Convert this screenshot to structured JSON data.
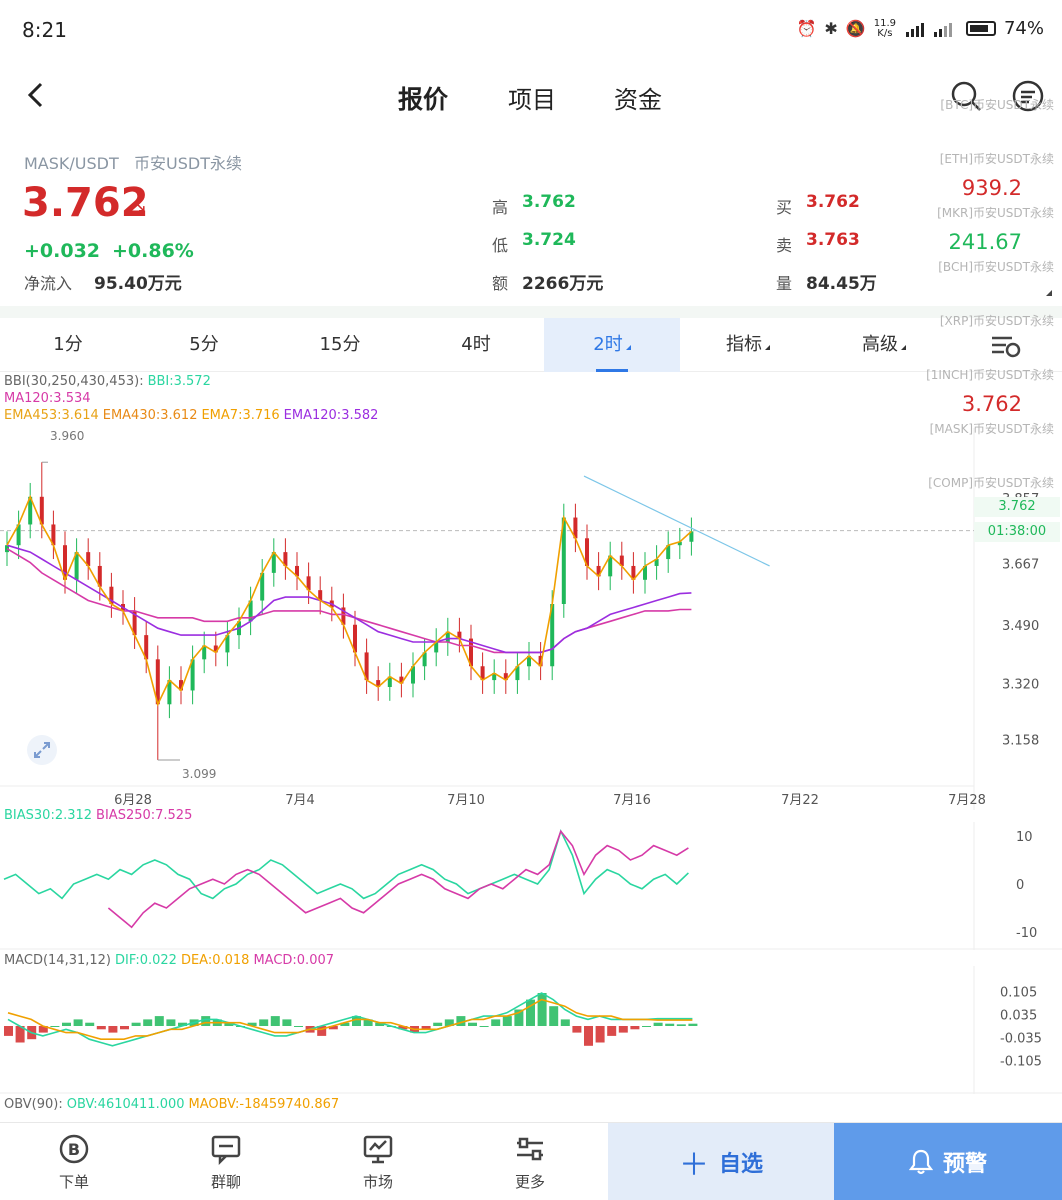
{
  "status": {
    "time": "8:21",
    "net_speed_top": "11.9",
    "net_speed_bottom": "K/s",
    "battery": "74%",
    "battery_level": 0.74
  },
  "nav": {
    "tabs": [
      "报价",
      "项目",
      "资金"
    ],
    "active_tab": "报价"
  },
  "ticker_overlay": {
    "items": [
      {
        "label": "[BTC]币安USDT永续",
        "price": ""
      },
      {
        "label": "[ETH]币安USDT永续",
        "price": "939.2"
      },
      {
        "label": "[MKR]币安USDT永续",
        "price": "241.67"
      },
      {
        "label": "[BCH]币安USDT永续",
        "price": ""
      },
      {
        "label": "[XRP]币安USDT永续",
        "price": "3.762"
      },
      {
        "label": "[1INCH]币安USDT永续",
        "price": ""
      },
      {
        "label": "[MASK]币安USDT永续",
        "price": ""
      },
      {
        "label": "[COMP]币安USDT永续",
        "price": ""
      }
    ],
    "price_colors": [
      "#d32a2a",
      "#1fb85a",
      "#d32a2a"
    ]
  },
  "quote": {
    "pair": "MASK/USDT",
    "exchange": "币安USDT永续",
    "price": "3.762",
    "trend_icon": "arrow-down-right",
    "change": "+0.032",
    "change_pct": "+0.86%",
    "net_inflow_label": "净流入",
    "net_inflow": "95.40万元",
    "high_label": "高",
    "high": "3.762",
    "low_label": "低",
    "low": "3.724",
    "amount_label": "额",
    "amount": "2266万元",
    "bid_label": "买",
    "bid": "3.762",
    "ask_label": "卖",
    "ask": "3.763",
    "volume_label": "量",
    "volume": "84.45万"
  },
  "timeframes": {
    "items": [
      "1分",
      "5分",
      "15分",
      "4时",
      "2时",
      "指标",
      "高级"
    ],
    "active": "2时",
    "settings_icon": "chart-settings-icon"
  },
  "main_chart": {
    "legend_bbi": "BBI(30,250,430,453):",
    "legend_bbi_val": "BBI:3.572",
    "legend_ma": "MA120:3.534",
    "legend_ema453": "EMA453:3.614",
    "legend_ema430": "EMA430:3.612",
    "legend_ema7": "EMA7:3.716",
    "legend_ema120": "EMA120:3.582",
    "high_marker": "3.960",
    "low_marker": "3.099",
    "price_box": "3.762",
    "countdown_box": "01:38:00",
    "expand_icon": "expand-icon"
  },
  "bias": {
    "legend_30": "BIAS30:2.312",
    "legend_250": "BIAS250:7.525"
  },
  "macd": {
    "legend_name": "MACD(14,31,12)",
    "legend_dif": "DIF:0.022",
    "legend_dea": "DEA:0.018",
    "legend_macd": "MACD:0.007"
  },
  "obv": {
    "legend_name": "OBV(90):",
    "legend_obv": "OBV:4610411.000",
    "legend_maobv": "MAOBV:-18459740.867"
  },
  "chart_data": [
    {
      "type": "candlestick",
      "title": "",
      "x": [
        "6月28",
        "7月4",
        "7月10",
        "7月16",
        "7月22",
        "7月28"
      ],
      "y_ticks": [
        3.857,
        3.667,
        3.49,
        3.32,
        3.158
      ],
      "y_tick_labels": [
        "3.857",
        "3.667",
        "3.490",
        "3.320",
        "3.158"
      ],
      "ylim": [
        3.07,
        4.03
      ],
      "high": 3.96,
      "low": 3.099,
      "last": 3.762,
      "series": [
        {
          "name": "close",
          "values": [
            3.72,
            3.78,
            3.86,
            3.78,
            3.72,
            3.62,
            3.7,
            3.66,
            3.6,
            3.55,
            3.53,
            3.46,
            3.39,
            3.26,
            3.33,
            3.3,
            3.39,
            3.43,
            3.41,
            3.46,
            3.5,
            3.56,
            3.64,
            3.7,
            3.66,
            3.63,
            3.59,
            3.56,
            3.54,
            3.49,
            3.41,
            3.33,
            3.31,
            3.34,
            3.32,
            3.37,
            3.41,
            3.44,
            3.47,
            3.45,
            3.37,
            3.33,
            3.35,
            3.33,
            3.37,
            3.4,
            3.37,
            3.55,
            3.8,
            3.74,
            3.66,
            3.63,
            3.69,
            3.66,
            3.62,
            3.66,
            3.68,
            3.72,
            3.73,
            3.76
          ]
        },
        {
          "name": "MA120",
          "values": [
            3.71,
            3.69,
            3.67,
            3.64,
            3.62,
            3.6,
            3.58,
            3.56,
            3.55,
            3.54,
            3.53,
            3.53,
            3.52,
            3.51,
            3.51,
            3.51,
            3.51,
            3.5,
            3.5,
            3.5,
            3.51,
            3.51,
            3.52,
            3.53,
            3.53,
            3.53,
            3.53,
            3.53,
            3.52,
            3.52,
            3.51,
            3.5,
            3.49,
            3.48,
            3.47,
            3.46,
            3.45,
            3.44,
            3.44,
            3.43,
            3.43,
            3.42,
            3.41,
            3.41,
            3.41,
            3.41,
            3.41,
            3.42,
            3.45,
            3.47,
            3.48,
            3.49,
            3.5,
            3.51,
            3.52,
            3.53,
            3.53,
            3.53,
            3.534,
            3.534
          ]
        },
        {
          "name": "EMA120",
          "values": [
            3.72,
            3.71,
            3.7,
            3.68,
            3.66,
            3.64,
            3.62,
            3.6,
            3.58,
            3.56,
            3.54,
            3.52,
            3.5,
            3.48,
            3.47,
            3.46,
            3.46,
            3.46,
            3.46,
            3.47,
            3.48,
            3.5,
            3.53,
            3.56,
            3.57,
            3.57,
            3.57,
            3.56,
            3.55,
            3.53,
            3.51,
            3.49,
            3.47,
            3.46,
            3.45,
            3.44,
            3.44,
            3.44,
            3.45,
            3.45,
            3.44,
            3.43,
            3.42,
            3.41,
            3.41,
            3.41,
            3.41,
            3.42,
            3.45,
            3.47,
            3.48,
            3.5,
            3.52,
            3.53,
            3.54,
            3.55,
            3.56,
            3.57,
            3.58,
            3.582
          ]
        }
      ]
    },
    {
      "type": "line",
      "title": "",
      "y_ticks": [
        10,
        0,
        -10
      ],
      "y_tick_labels": [
        "10",
        "0",
        "-10"
      ],
      "series": [
        {
          "name": "BIAS30",
          "values": [
            1,
            2,
            0,
            -2,
            -1,
            -3,
            0,
            1,
            2,
            1,
            3,
            2,
            4,
            5,
            4,
            2,
            1,
            -2,
            -3,
            -1,
            0,
            2,
            3,
            5,
            4,
            2,
            0,
            -2,
            -1,
            0,
            -1,
            -3,
            -2,
            0,
            2,
            3,
            4,
            3,
            1,
            0,
            -2,
            -1,
            0,
            1,
            2,
            1,
            0,
            3,
            11,
            6,
            -2,
            1,
            3,
            2,
            0,
            -1,
            1,
            2,
            0,
            2.312
          ]
        },
        {
          "name": "BIAS250",
          "values": [
            null,
            null,
            null,
            null,
            null,
            null,
            null,
            null,
            null,
            -5,
            -7,
            -9,
            -6,
            -4,
            -5,
            -3,
            -1,
            0,
            1,
            0,
            2,
            3,
            2,
            0,
            -2,
            -4,
            -6,
            -5,
            -4,
            -3,
            -5,
            -6,
            -4,
            -2,
            0,
            1,
            2,
            1,
            -1,
            -2,
            -3,
            -1,
            0,
            -1,
            1,
            3,
            2,
            4,
            11,
            8,
            2,
            6,
            8,
            7,
            5,
            6,
            8,
            7,
            6,
            7.525
          ]
        }
      ]
    },
    {
      "type": "bar",
      "title": "",
      "y_ticks": [
        0.105,
        0.035,
        -0.035,
        -0.105
      ],
      "y_tick_labels": [
        "0.105",
        "0.035",
        "-0.035",
        "-0.105"
      ],
      "series": [
        {
          "name": "MACD",
          "values": [
            -0.03,
            -0.05,
            -0.04,
            -0.02,
            0,
            0.01,
            0.02,
            0.01,
            -0.01,
            -0.02,
            -0.01,
            0.01,
            0.02,
            0.03,
            0.02,
            0.01,
            0.02,
            0.03,
            0.02,
            0.01,
            0,
            0.01,
            0.02,
            0.03,
            0.02,
            0,
            -0.02,
            -0.03,
            -0.01,
            0.01,
            0.03,
            0.02,
            0.01,
            0,
            -0.01,
            -0.02,
            -0.01,
            0.01,
            0.02,
            0.03,
            0.01,
            0,
            0.02,
            0.03,
            0.05,
            0.08,
            0.1,
            0.06,
            0.02,
            -0.02,
            -0.06,
            -0.05,
            -0.03,
            -0.02,
            -0.01,
            0,
            0.01,
            0.007,
            0.005,
            0.007
          ]
        },
        {
          "name": "DIF",
          "values": [
            0.02,
            0.0,
            -0.02,
            -0.03,
            -0.02,
            -0.01,
            -0.02,
            -0.04,
            -0.05,
            -0.06,
            -0.05,
            -0.04,
            -0.03,
            -0.02,
            -0.01,
            0.0,
            0.01,
            0.02,
            0.02,
            0.01,
            0.0,
            -0.01,
            -0.02,
            -0.03,
            -0.03,
            -0.02,
            -0.01,
            0.0,
            0.01,
            0.02,
            0.03,
            0.02,
            0.01,
            0.0,
            -0.01,
            -0.02,
            -0.02,
            -0.01,
            0.0,
            0.01,
            0.02,
            0.03,
            0.03,
            0.04,
            0.06,
            0.08,
            0.1,
            0.08,
            0.05,
            0.03,
            0.02,
            0.03,
            0.02,
            0.02,
            0.02,
            0.02,
            0.022,
            0.022,
            0.022,
            0.022
          ]
        },
        {
          "name": "DEA",
          "values": [
            0.04,
            0.03,
            0.02,
            0.0,
            -0.01,
            -0.02,
            -0.02,
            -0.03,
            -0.04,
            -0.04,
            -0.04,
            -0.03,
            -0.03,
            -0.02,
            -0.01,
            -0.01,
            0.0,
            0.01,
            0.01,
            0.01,
            0.01,
            0.0,
            -0.01,
            -0.02,
            -0.02,
            -0.02,
            -0.01,
            -0.01,
            0.0,
            0.01,
            0.02,
            0.02,
            0.01,
            0.01,
            0.0,
            -0.01,
            -0.01,
            -0.01,
            0.0,
            0.01,
            0.02,
            0.02,
            0.03,
            0.03,
            0.04,
            0.06,
            0.08,
            0.07,
            0.06,
            0.04,
            0.03,
            0.03,
            0.03,
            0.02,
            0.02,
            0.02,
            0.018,
            0.018,
            0.018,
            0.018
          ]
        }
      ]
    }
  ],
  "bottom": {
    "items": [
      {
        "label": "下单",
        "icon": "b-coin-icon"
      },
      {
        "label": "群聊",
        "icon": "chat-icon"
      },
      {
        "label": "市场",
        "icon": "market-chart-icon"
      },
      {
        "label": "更多",
        "icon": "more-sliders-icon"
      }
    ],
    "fav_label": "自选",
    "alert_label": "预警"
  },
  "colors": {
    "up": "#1fb85a",
    "down": "#d32a2a",
    "accent": "#2f78e6",
    "ma120": "#d63aa7",
    "ema453": "#e8a317",
    "ema430": "#e88a17",
    "ema7": "#f0a000",
    "ema120": "#9b2ee0",
    "bias30": "#2ad6a0",
    "bias250": "#d63aa7",
    "dif": "#2ad6a0",
    "dea": "#f0a000"
  }
}
